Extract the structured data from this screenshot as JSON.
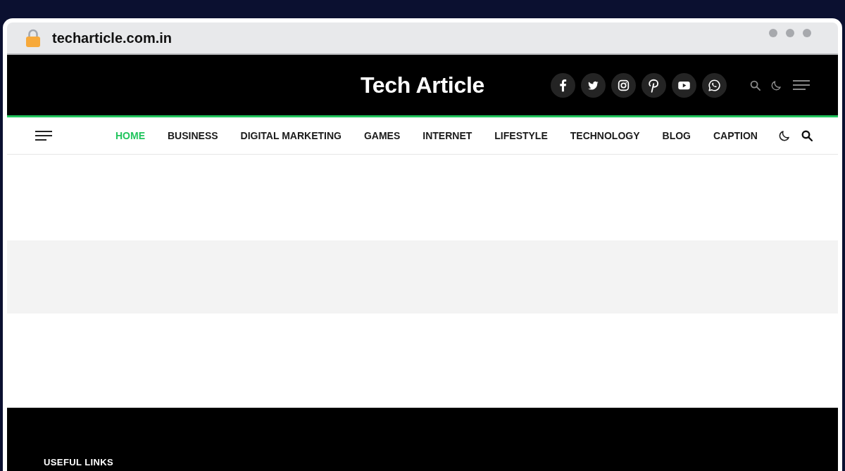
{
  "browser": {
    "url": "techarticle.com.in"
  },
  "header": {
    "title": "Tech Article",
    "social_links": [
      {
        "kind": "facebook"
      },
      {
        "kind": "twitter"
      },
      {
        "kind": "instagram"
      },
      {
        "kind": "pinterest"
      },
      {
        "kind": "youtube"
      },
      {
        "kind": "whatsapp"
      }
    ]
  },
  "nav": {
    "items": [
      {
        "label": "HOME",
        "selected": true
      },
      {
        "label": "BUSINESS",
        "selected": false
      },
      {
        "label": "DIGITAL MARKETING",
        "selected": false
      },
      {
        "label": "GAMES",
        "selected": false
      },
      {
        "label": "INTERNET",
        "selected": false
      },
      {
        "label": "LIFESTYLE",
        "selected": false
      },
      {
        "label": "TECHNOLOGY",
        "selected": false
      },
      {
        "label": "BLOG",
        "selected": false
      },
      {
        "label": "CAPTION",
        "selected": false
      }
    ]
  },
  "footer": {
    "heading": "USEFUL LINKS"
  }
}
